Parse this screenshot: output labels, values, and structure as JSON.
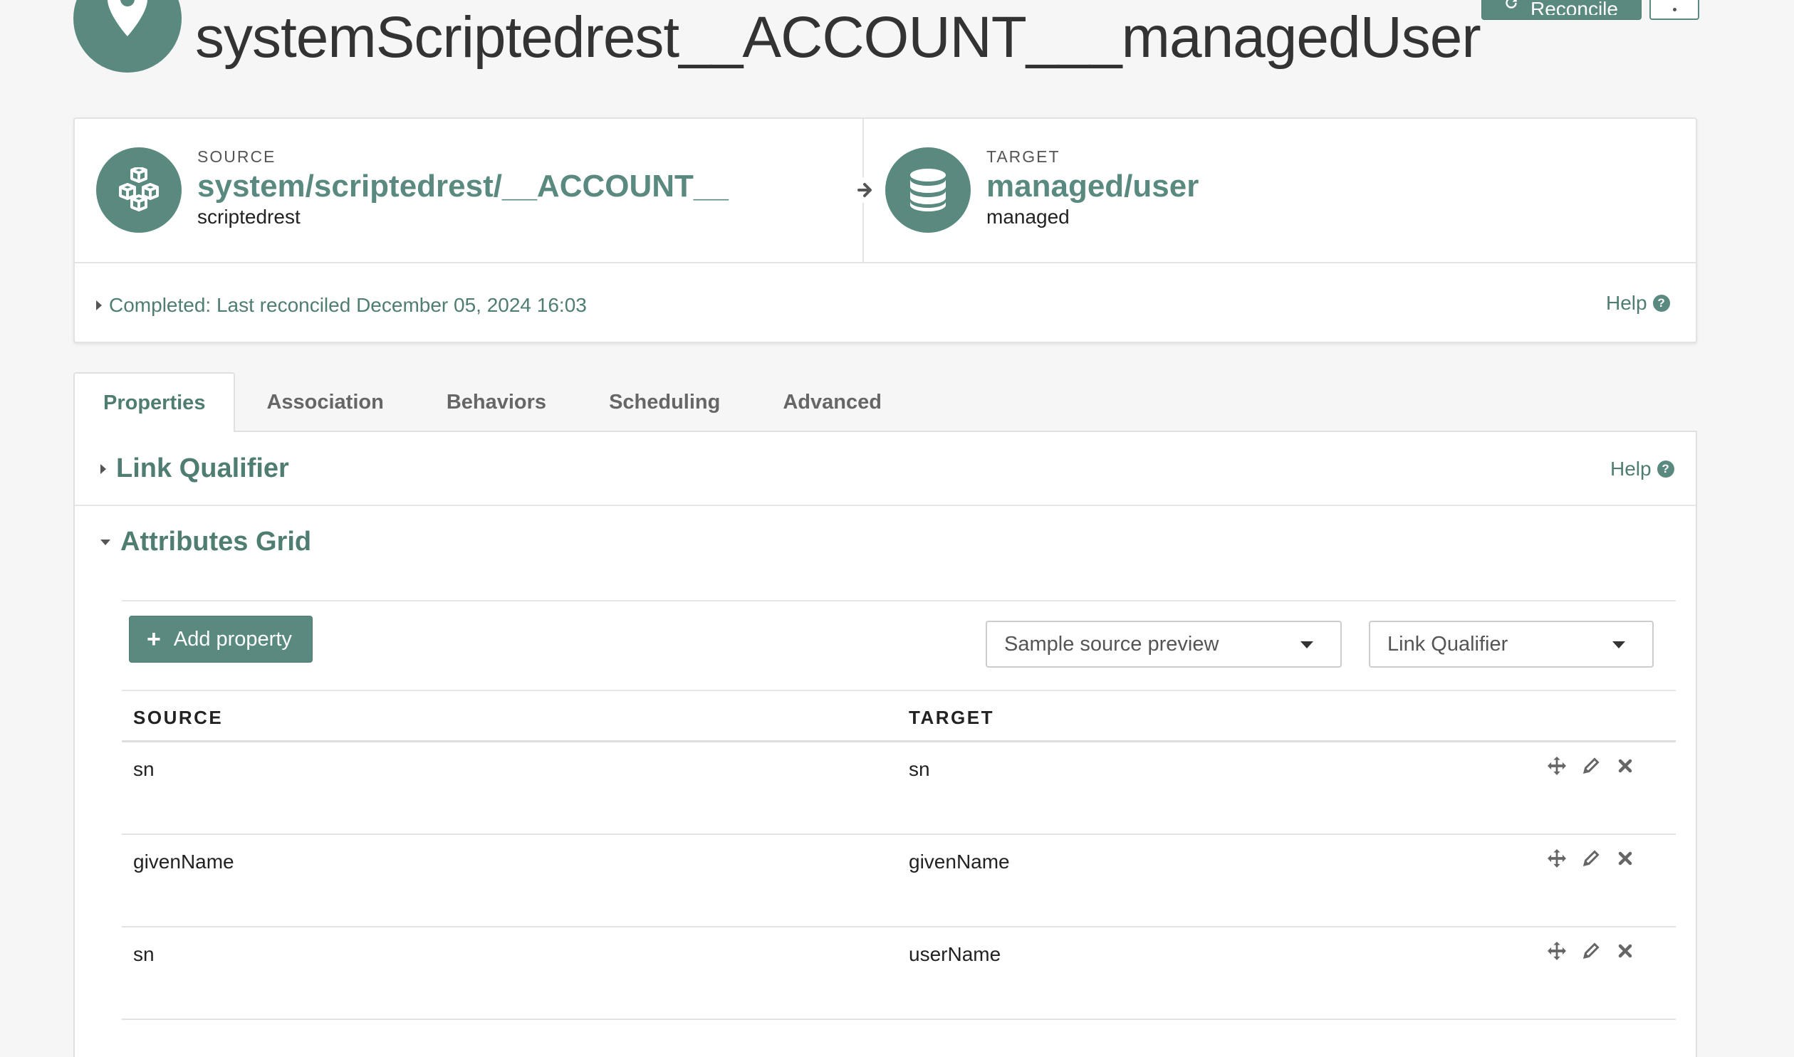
{
  "header": {
    "title": "systemScriptedrest__ACCOUNT___managedUser",
    "reconcile_label": "Reconcile"
  },
  "mapping": {
    "source": {
      "label": "SOURCE",
      "path": "system/scriptedrest/__ACCOUNT__",
      "sub": "scriptedrest"
    },
    "target": {
      "label": "TARGET",
      "path": "managed/user",
      "sub": "managed"
    },
    "status": "Completed: Last reconciled December 05, 2024 16:03",
    "help_label": "Help"
  },
  "tabs": [
    {
      "label": "Properties",
      "active": true
    },
    {
      "label": "Association"
    },
    {
      "label": "Behaviors"
    },
    {
      "label": "Scheduling"
    },
    {
      "label": "Advanced"
    }
  ],
  "sections": {
    "link_qualifier": "Link Qualifier",
    "attributes_grid": "Attributes Grid",
    "help_label": "Help"
  },
  "grid": {
    "add_property_label": "Add property",
    "sample_source_preview": "Sample source preview",
    "link_qualifier_select": "Link Qualifier",
    "columns": {
      "source": "SOURCE",
      "target": "TARGET"
    },
    "rows": [
      {
        "source": "sn",
        "target": "sn"
      },
      {
        "source": "givenName",
        "target": "givenName"
      },
      {
        "source": "sn",
        "target": "userName"
      }
    ]
  },
  "colors": {
    "accent": "#5a8a7f"
  }
}
